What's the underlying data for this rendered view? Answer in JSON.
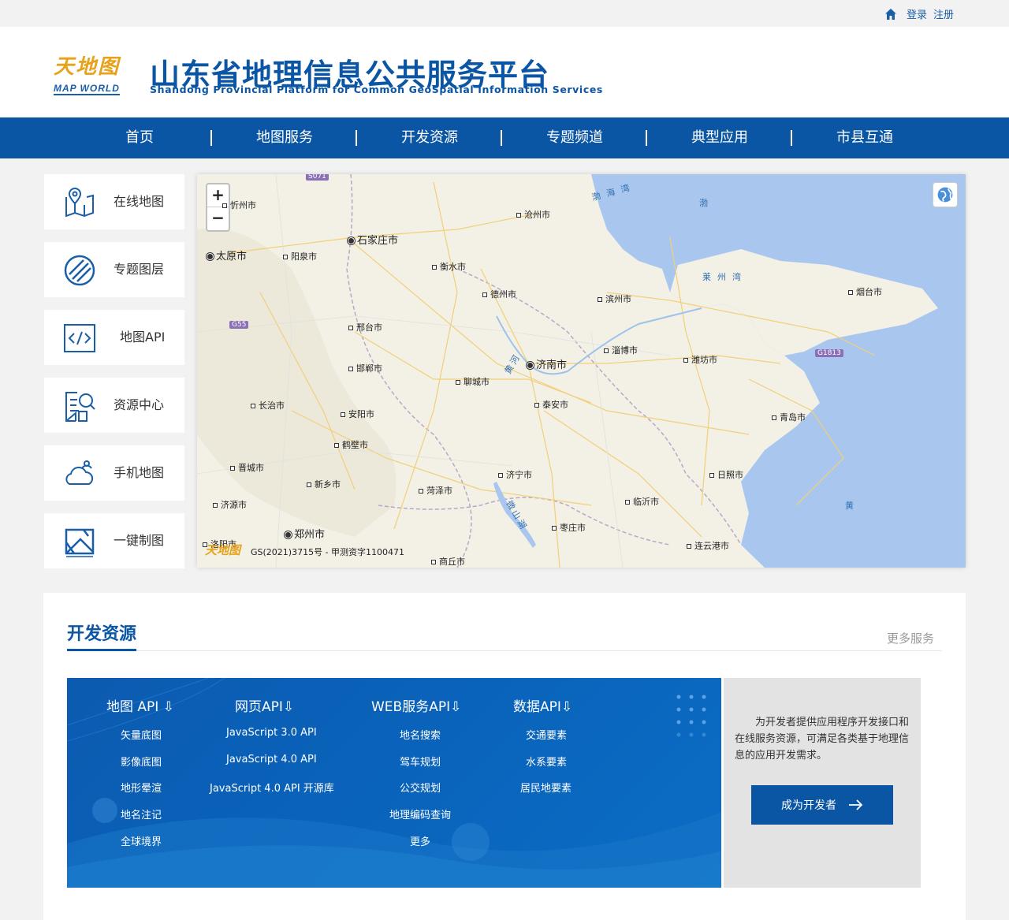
{
  "topbar": {
    "login": "登录",
    "register": "注册"
  },
  "header": {
    "logo_cn": "天地图",
    "logo_en": "MAP WORLD",
    "title": "山东省地理信息公共服务平台",
    "subtitle": "Shandong Provincial Platform for Common GeoSpatial Information Services"
  },
  "nav": [
    "首页",
    "地图服务",
    "开发资源",
    "专题频道",
    "典型应用",
    "市县互通"
  ],
  "sidebar": [
    {
      "label": "在线地图",
      "icon": "map-pin-icon"
    },
    {
      "label": "专题图层",
      "icon": "layer-icon"
    },
    {
      "label": "地图API",
      "icon": "code-icon"
    },
    {
      "label": "资源中心",
      "icon": "resource-search-icon"
    },
    {
      "label": "手机地图",
      "icon": "mobile-cloud-icon"
    },
    {
      "label": "一键制图",
      "icon": "mapping-icon"
    }
  ],
  "map": {
    "zoom_in": "+",
    "zoom_out": "−",
    "copyright": "GS(2021)3715号 - 甲测资字1100471",
    "logo": "天地图",
    "cities": [
      {
        "name": "忻州市",
        "cap": false
      },
      {
        "name": "沧州市",
        "cap": false
      },
      {
        "name": "石家庄市",
        "cap": true
      },
      {
        "name": "太原市",
        "cap": true
      },
      {
        "name": "阳泉市",
        "cap": false
      },
      {
        "name": "衡水市",
        "cap": false
      },
      {
        "name": "德州市",
        "cap": false
      },
      {
        "name": "滨州市",
        "cap": false
      },
      {
        "name": "烟台市",
        "cap": false
      },
      {
        "name": "邢台市",
        "cap": false
      },
      {
        "name": "淄博市",
        "cap": false
      },
      {
        "name": "潍坊市",
        "cap": false
      },
      {
        "name": "济南市",
        "cap": true
      },
      {
        "name": "邯郸市",
        "cap": false
      },
      {
        "name": "聊城市",
        "cap": false
      },
      {
        "name": "泰安市",
        "cap": false
      },
      {
        "name": "长治市",
        "cap": false
      },
      {
        "name": "安阳市",
        "cap": false
      },
      {
        "name": "青岛市",
        "cap": false
      },
      {
        "name": "鹤壁市",
        "cap": false
      },
      {
        "name": "晋城市",
        "cap": false
      },
      {
        "name": "济宁市",
        "cap": false
      },
      {
        "name": "日照市",
        "cap": false
      },
      {
        "name": "新乡市",
        "cap": false
      },
      {
        "name": "菏泽市",
        "cap": false
      },
      {
        "name": "临沂市",
        "cap": false
      },
      {
        "name": "济源市",
        "cap": false
      },
      {
        "name": "枣庄市",
        "cap": false
      },
      {
        "name": "郑州市",
        "cap": true
      },
      {
        "name": "洛阳市",
        "cap": false
      },
      {
        "name": "连云港市",
        "cap": false
      },
      {
        "name": "商丘市",
        "cap": false
      }
    ],
    "seas": [
      "渤海湾",
      "渤",
      "莱州湾",
      "黄"
    ],
    "roads": [
      "S071",
      "G55",
      "G1813"
    ],
    "rivers": [
      "黄河",
      "微山湖"
    ]
  },
  "dev": {
    "title": "开发资源",
    "more": "更多服务",
    "columns": [
      {
        "head": "地图 API",
        "items": [
          "矢量底图",
          "影像底图",
          "地形晕渲",
          "地名注记",
          "全球境界"
        ]
      },
      {
        "head": "网页API",
        "items": [
          "JavaScript 3.0 API",
          "JavaScript 4.0 API",
          "JavaScript 4.0 API 开源库"
        ]
      },
      {
        "head": "WEB服务API",
        "items": [
          "地名搜索",
          "驾车规划",
          "公交规划",
          "地理编码查询",
          "更多"
        ]
      },
      {
        "head": "数据API",
        "items": [
          "交通要素",
          "水系要素",
          "居民地要素"
        ]
      }
    ],
    "info_text": "为开发者提供应用程序开发接口和在线服务资源，可满足各类基于地理信息的应用开发需求。",
    "cta": "成为开发者"
  },
  "colors": {
    "brand_blue": "#0b56a4",
    "logo_orange": "#e8a21a",
    "sea": "#a9c7ee"
  }
}
